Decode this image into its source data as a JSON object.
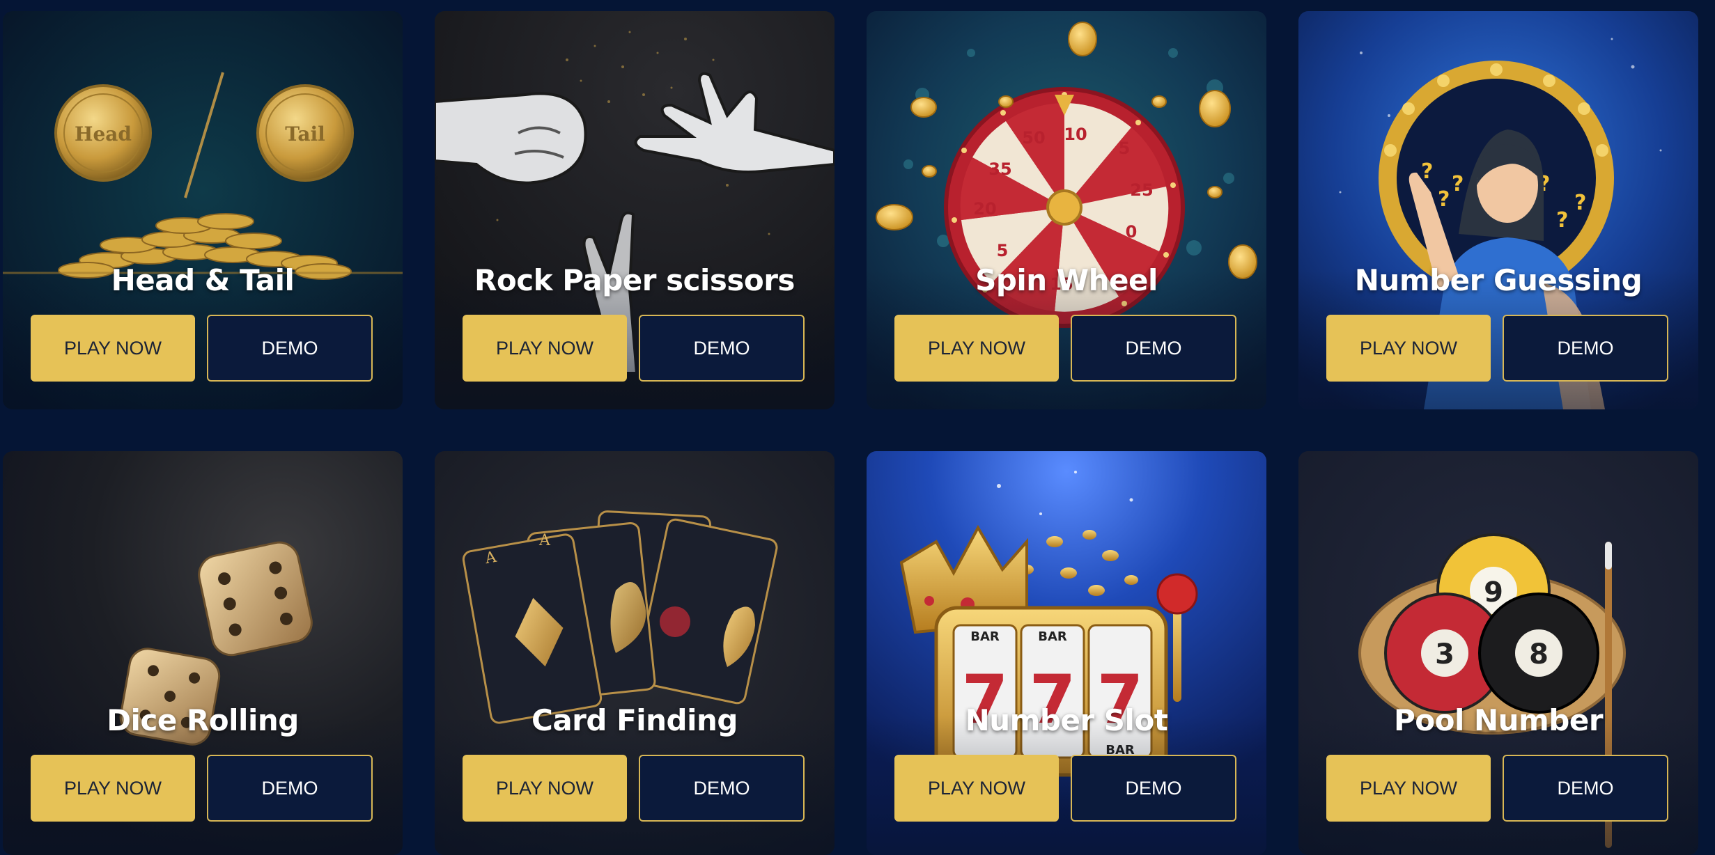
{
  "colors": {
    "page_background": "#051535",
    "play_button": "#e6c257",
    "demo_button": "#0b1a3b",
    "demo_border": "#d8b755",
    "title_text": "#ffffff"
  },
  "games": [
    {
      "title": "Head & Tail",
      "play_label": "PLAY NOW",
      "demo_label": "DEMO",
      "coin_left": "Head",
      "coin_right": "Tail",
      "icon": "coin-toss-icon"
    },
    {
      "title": "Rock Paper scissors",
      "play_label": "PLAY NOW",
      "demo_label": "DEMO",
      "icon": "hand-gestures-icon"
    },
    {
      "title": "Spin Wheel",
      "play_label": "PLAY NOW",
      "demo_label": "DEMO",
      "icon": "prize-wheel-icon",
      "wheel_numbers": [
        "10",
        "5",
        "25",
        "0",
        "15",
        "5",
        "20",
        "35",
        "50"
      ]
    },
    {
      "title": "Number Guessing",
      "play_label": "PLAY NOW",
      "demo_label": "DEMO",
      "icon": "thinking-person-icon",
      "marks": "?"
    },
    {
      "title": "Dice Rolling",
      "play_label": "PLAY NOW",
      "demo_label": "DEMO",
      "icon": "dice-icon"
    },
    {
      "title": "Card Finding",
      "play_label": "PLAY NOW",
      "demo_label": "DEMO",
      "icon": "playing-cards-icon",
      "card_letter": "A"
    },
    {
      "title": "Number Slot",
      "play_label": "PLAY NOW",
      "demo_label": "DEMO",
      "icon": "slot-machine-icon",
      "reel_symbol": "7",
      "bar_label": "BAR"
    },
    {
      "title": "Pool Number",
      "play_label": "PLAY NOW",
      "demo_label": "DEMO",
      "icon": "billiard-balls-icon",
      "balls": [
        "9",
        "3",
        "8"
      ]
    }
  ]
}
